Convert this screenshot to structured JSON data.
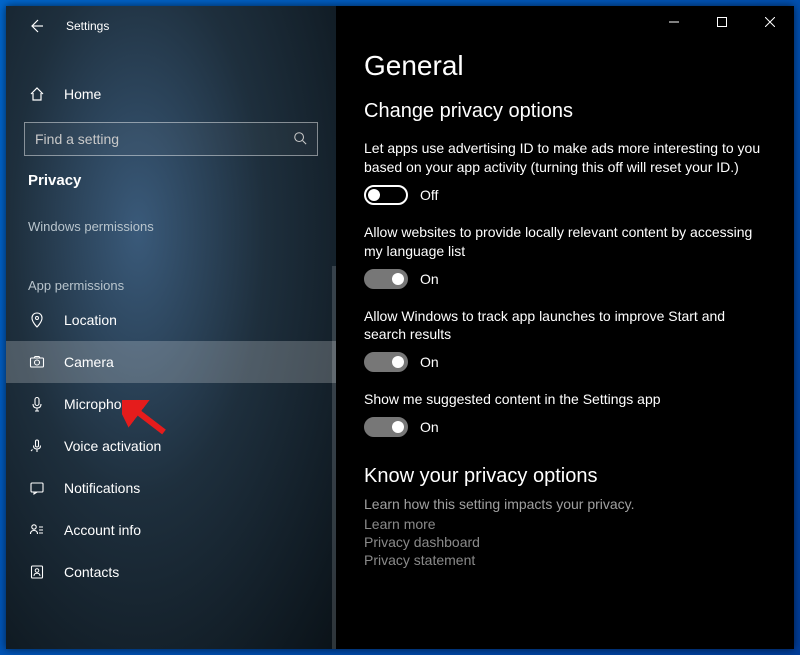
{
  "titlebar": {
    "app_name": "Settings"
  },
  "sidebar": {
    "home": "Home",
    "search_placeholder": "Find a setting",
    "category": "Privacy",
    "section_a": "Windows permissions",
    "section_b": "App permissions",
    "items": [
      {
        "label": "Location"
      },
      {
        "label": "Camera"
      },
      {
        "label": "Microphone"
      },
      {
        "label": "Voice activation"
      },
      {
        "label": "Notifications"
      },
      {
        "label": "Account info"
      },
      {
        "label": "Contacts"
      }
    ]
  },
  "main": {
    "page_title": "General",
    "section_title": "Change privacy options",
    "options": [
      {
        "desc": "Let apps use advertising ID to make ads more interesting to you based on your app activity (turning this off will reset your ID.)",
        "on": false,
        "state": "Off"
      },
      {
        "desc": "Allow websites to provide locally relevant content by accessing my language list",
        "on": true,
        "state": "On"
      },
      {
        "desc": "Allow Windows to track app launches to improve Start and search results",
        "on": true,
        "state": "On"
      },
      {
        "desc": "Show me suggested content in the Settings app",
        "on": true,
        "state": "On"
      }
    ],
    "know": {
      "title": "Know your privacy options",
      "sub": "Learn how this setting impacts your privacy.",
      "links": [
        "Learn more",
        "Privacy dashboard",
        "Privacy statement"
      ]
    }
  }
}
